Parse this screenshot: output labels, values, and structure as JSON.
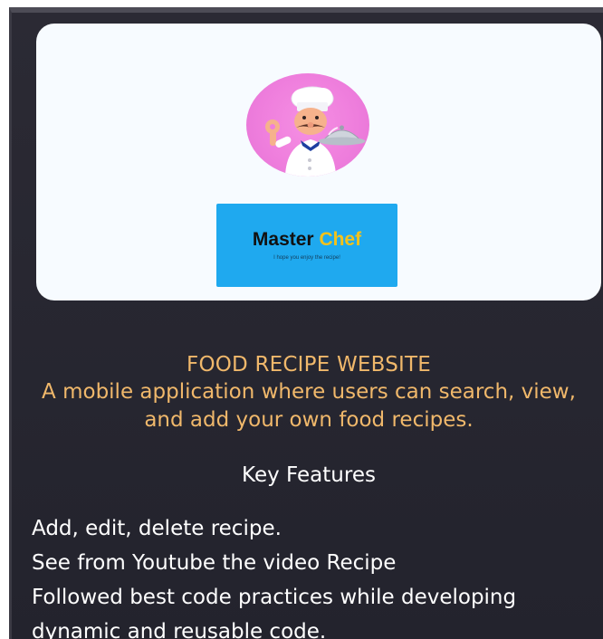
{
  "hero": {
    "logo_icon": "chef-holding-cloche",
    "brand": {
      "word1": "Master",
      "word2": "Chef",
      "tagline": "I hope you enjoy the recipe!"
    }
  },
  "project": {
    "title": "FOOD RECIPE WEBSITE",
    "description": "A mobile application where users can search, view, and add your own food recipes."
  },
  "features": {
    "heading": "Key Features",
    "items": [
      "Add, edit, delete recipe.",
      "See from Youtube the video Recipe",
      "Followed best code practices while developing",
      "dynamic and reusable code."
    ]
  },
  "colors": {
    "background": "#2b2a34",
    "hero_background": "#f7fbff",
    "badge_pink": "#ef7fdd",
    "brand_box_blue": "#1fa9ef",
    "brand_yellow": "#f3c21b",
    "title_orange": "#f0b86b",
    "text_white": "#ffffff"
  }
}
